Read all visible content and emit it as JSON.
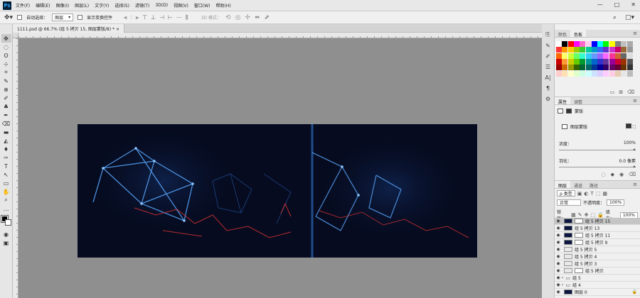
{
  "menubar": {
    "logo": "Ps",
    "items": [
      "文件(F)",
      "编辑(E)",
      "图像(I)",
      "图层(L)",
      "文字(Y)",
      "选择(S)",
      "滤镜(T)",
      "3D(D)",
      "视图(V)",
      "窗口(W)",
      "帮助(H)"
    ],
    "minimize": "—",
    "maximize": "□",
    "close": "✕"
  },
  "options": {
    "auto_select_label": "自动选择：",
    "auto_select_value": "图层",
    "show_transform_label": "显示变换控件",
    "mode_3d": "3D 模式：",
    "align_icons": [
      "⫷",
      "⫶",
      "⫸",
      "⊤",
      "⊥",
      "⊣",
      "⊢",
      "⋯",
      "⫼"
    ]
  },
  "document": {
    "tab_title": "1111.psd @ 66.7% (组 5 拷贝 15, 图层蒙版/8) *",
    "tab_close": "×"
  },
  "tools": [
    "✥",
    "◌",
    "ʘ",
    "⊹",
    "⌗",
    "✎",
    "⊕",
    "✐",
    "♣",
    "✒",
    "⌫",
    "▬",
    "◭",
    "♦",
    "✑",
    "T",
    "↖",
    "▭",
    "✋",
    "⌕",
    "…"
  ],
  "swatches_panel": {
    "tabs": [
      "颜色",
      "色板"
    ],
    "active_tab": 1,
    "colors": [
      "#ffffff",
      "#000000",
      "#ff0000",
      "#ff00ff",
      "#ff66cc",
      "#ffccee",
      "#0000ff",
      "#00ffff",
      "#00ff00",
      "#ffff00",
      "#808080",
      "#c0c0c0",
      "#aaaaaa",
      "#ff3333",
      "#ff9900",
      "#ffcc00",
      "#99cc00",
      "#33cc33",
      "#00cc99",
      "#0099cc",
      "#3366ff",
      "#6633cc",
      "#cc33cc",
      "#cc0066",
      "#996633",
      "#999999",
      "#ff6600",
      "#ffff66",
      "#ccff33",
      "#66ff66",
      "#33ffcc",
      "#33ccff",
      "#6699ff",
      "#9966ff",
      "#ff66ff",
      "#ff3399",
      "#cc6633",
      "#666666",
      "#dddddd",
      "#cc0000",
      "#ff9933",
      "#cccc00",
      "#66cc00",
      "#009933",
      "#009999",
      "#0066cc",
      "#3333cc",
      "#663399",
      "#990099",
      "#cc0033",
      "#993300",
      "#555555",
      "#990000",
      "#cc6600",
      "#999900",
      "#336600",
      "#006633",
      "#006666",
      "#003399",
      "#000099",
      "#330066",
      "#660066",
      "#660033",
      "#663300",
      "#333333",
      "#ffcccc",
      "#ffe0b3",
      "#ffffcc",
      "#e0ffcc",
      "#ccffe6",
      "#ccffff",
      "#cce0ff",
      "#d9ccff",
      "#ffccff",
      "#ffcce6",
      "#e6ccb3",
      "#e6e6e6",
      "#bbbbbb"
    ]
  },
  "properties_panel": {
    "tabs": [
      "属性",
      "调整"
    ],
    "active_tab": 0,
    "type_label": "蒙版",
    "section_label": "图层蒙版",
    "density_label": "浓度：",
    "density_value": "100%",
    "feather_label": "羽化：",
    "feather_value": "0.0 像素"
  },
  "layers_panel": {
    "tabs": [
      "图层",
      "通道",
      "路径"
    ],
    "active_tab": 0,
    "filter_label": "ρ 类型",
    "blend_mode": "正常",
    "opacity_label": "不透明度：",
    "opacity_value": "100%",
    "lock_label": "锁定：",
    "fill_label": "填充：",
    "fill_value": "100%",
    "layers": [
      {
        "name": "组 5 拷贝 15",
        "selected": true,
        "thumb": "dark",
        "mask": true
      },
      {
        "name": "组 5 拷贝 13",
        "selected": false,
        "thumb": "dark",
        "mask": false
      },
      {
        "name": "组 5 拷贝 11",
        "selected": false,
        "thumb": "dark",
        "mask": true
      },
      {
        "name": "组 5 拷贝 9",
        "selected": false,
        "thumb": "dark",
        "mask": true
      },
      {
        "name": "组 5 拷贝 5",
        "selected": false,
        "thumb": "light",
        "mask": false
      },
      {
        "name": "组 5 拷贝 4",
        "selected": false,
        "thumb": "light",
        "mask": false
      },
      {
        "name": "组 5 拷贝 3",
        "selected": false,
        "thumb": "light",
        "mask": false
      },
      {
        "name": "组 5 拷贝",
        "selected": false,
        "thumb": "light",
        "mask": true
      },
      {
        "name": "组 5",
        "selected": false,
        "folder": true
      },
      {
        "name": "组 4",
        "selected": false,
        "folder": true
      },
      {
        "name": "图层 0",
        "selected": false,
        "thumb": "dark",
        "mask": false,
        "locked": true
      }
    ]
  }
}
